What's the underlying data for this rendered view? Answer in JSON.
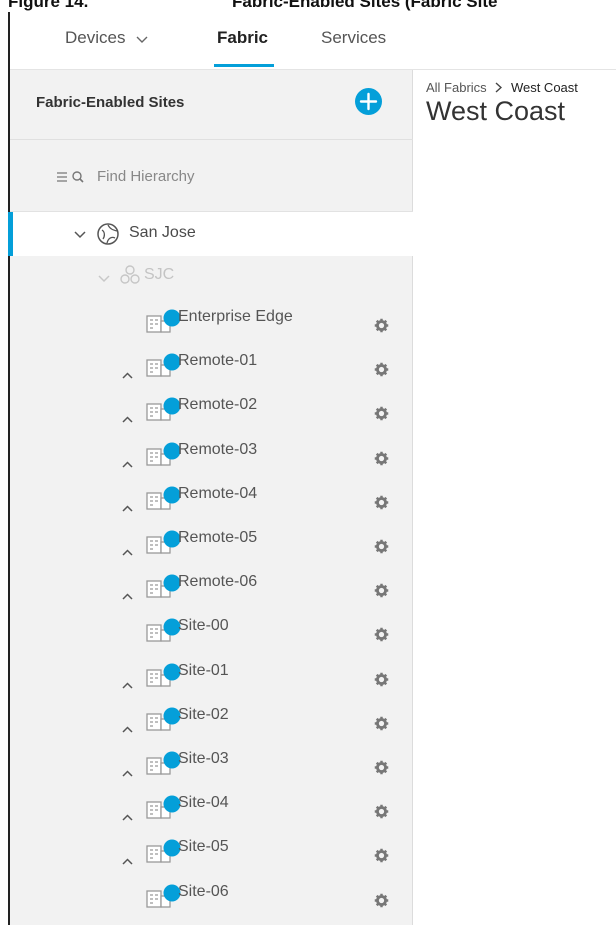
{
  "caption": {
    "label": "Figure 14.",
    "title": "Fabric-Enabled Sites (Fabric Site"
  },
  "nav": {
    "tabs": [
      {
        "label": "Devices"
      },
      {
        "label": "Fabric"
      },
      {
        "label": "Services"
      }
    ],
    "active_tab": "Fabric",
    "accent_color": "#049fd9"
  },
  "sidebar": {
    "title": "Fabric-Enabled Sites",
    "find_placeholder": "Find Hierarchy",
    "root": {
      "label": "San Jose"
    },
    "area": {
      "label": "SJC"
    },
    "sites": [
      {
        "label": "Enterprise Edge",
        "expandable": false
      },
      {
        "label": "Remote-01",
        "expandable": true
      },
      {
        "label": "Remote-02",
        "expandable": true
      },
      {
        "label": "Remote-03",
        "expandable": true
      },
      {
        "label": "Remote-04",
        "expandable": true
      },
      {
        "label": "Remote-05",
        "expandable": true
      },
      {
        "label": "Remote-06",
        "expandable": true
      },
      {
        "label": "Site-00",
        "expandable": false
      },
      {
        "label": "Site-01",
        "expandable": true
      },
      {
        "label": "Site-02",
        "expandable": true
      },
      {
        "label": "Site-03",
        "expandable": true
      },
      {
        "label": "Site-04",
        "expandable": true
      },
      {
        "label": "Site-05",
        "expandable": true
      },
      {
        "label": "Site-06",
        "expandable": false
      }
    ]
  },
  "content": {
    "breadcrumb": {
      "parent": "All Fabrics",
      "current": "West Coast"
    },
    "title": "West Coast"
  }
}
